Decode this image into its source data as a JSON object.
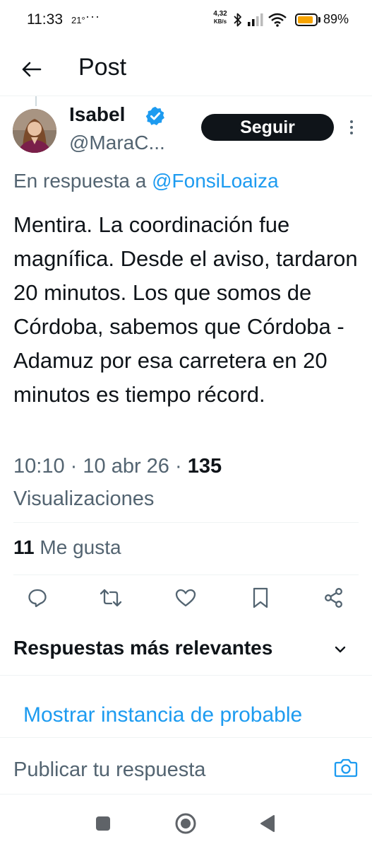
{
  "status_bar": {
    "time": "11:33",
    "temperature": "21°",
    "dots": "···",
    "net_speed_value": "4,32",
    "net_speed_unit": "KB/s",
    "battery_percent": "89%",
    "battery_level": 0.89,
    "battery_color": "#f7a300"
  },
  "header": {
    "title": "Post",
    "back_icon": "arrow-left-icon"
  },
  "post": {
    "author_name": "Isabel",
    "author_handle": "@MaraC...",
    "verified_icon": "verified-badge-icon",
    "verified_color": "#1d9bf0",
    "follow_label": "Seguir",
    "reply_prefix": "En respuesta a",
    "reply_handle": "@FonsiLoaiza",
    "text": "Mentira. La coordinación fue magnífica. Desde el aviso, tardaron 20 minutos. Los que somos de Córdoba, sabemos que Córdoba - Adamuz por esa carretera en 20 minutos es tiempo récord.",
    "time": "10:10",
    "date": "10 abr 26",
    "separator": "·",
    "views_count": "135",
    "views_label": "Visualizaciones",
    "likes_count": "11",
    "likes_label": "Me gusta"
  },
  "actions": [
    "reply-icon",
    "repost-icon",
    "like-icon",
    "bookmark-icon",
    "share-icon"
  ],
  "replies": {
    "sort_label": "Respuestas más relevantes",
    "show_probable": "Mostrar instancia de probable"
  },
  "composer": {
    "placeholder": "Publicar tu respuesta",
    "camera_icon": "camera-icon"
  },
  "colors": {
    "accent": "#1d9bf0",
    "text_primary": "#0f1419",
    "text_secondary": "#536471"
  }
}
